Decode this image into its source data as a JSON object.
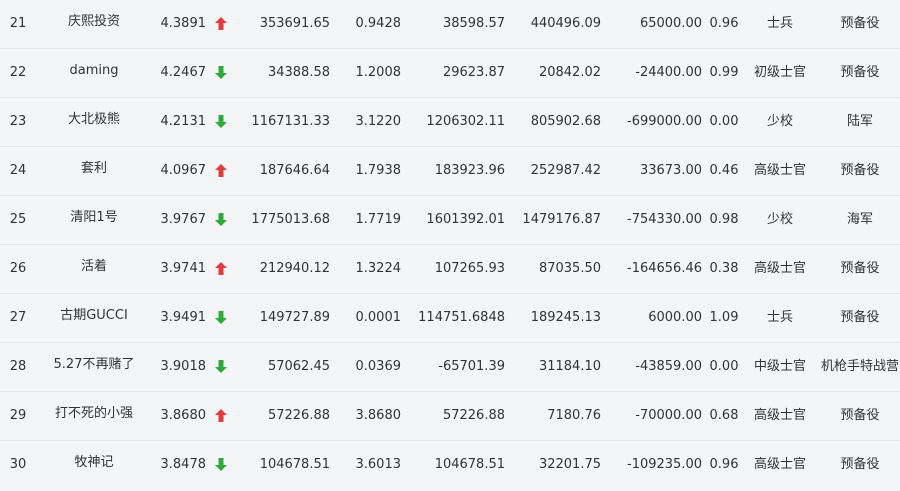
{
  "colors": {
    "up": "#e23b3b",
    "down": "#2faa3a"
  },
  "rows": [
    {
      "rank": "21",
      "name": "庆熙投资",
      "score": "4.3891",
      "trend": "up",
      "v1": "353691.65",
      "v2": "0.9428",
      "v3": "38598.57",
      "v4": "440496.09",
      "v5": "65000.00",
      "v6": "0.96",
      "military_rank": "士兵",
      "unit": "预备役"
    },
    {
      "rank": "22",
      "name": "daming",
      "score": "4.2467",
      "trend": "down",
      "v1": "34388.58",
      "v2": "1.2008",
      "v3": "29623.87",
      "v4": "20842.02",
      "v5": "-24400.00",
      "v6": "0.99",
      "military_rank": "初级士官",
      "unit": "预备役"
    },
    {
      "rank": "23",
      "name": "大北极熊",
      "score": "4.2131",
      "trend": "down",
      "v1": "1167131.33",
      "v2": "3.1220",
      "v3": "1206302.11",
      "v4": "805902.68",
      "v5": "-699000.00",
      "v6": "0.00",
      "military_rank": "少校",
      "unit": "陆军"
    },
    {
      "rank": "24",
      "name": "套利",
      "score": "4.0967",
      "trend": "up",
      "v1": "187646.64",
      "v2": "1.7938",
      "v3": "183923.96",
      "v4": "252987.42",
      "v5": "33673.00",
      "v6": "0.46",
      "military_rank": "高级士官",
      "unit": "预备役"
    },
    {
      "rank": "25",
      "name": "清阳1号",
      "score": "3.9767",
      "trend": "down",
      "v1": "1775013.68",
      "v2": "1.7719",
      "v3": "1601392.01",
      "v4": "1479176.87",
      "v5": "-754330.00",
      "v6": "0.98",
      "military_rank": "少校",
      "unit": "海军"
    },
    {
      "rank": "26",
      "name": "活着",
      "score": "3.9741",
      "trend": "up",
      "v1": "212940.12",
      "v2": "1.3224",
      "v3": "107265.93",
      "v4": "87035.50",
      "v5": "-164656.46",
      "v6": "0.38",
      "military_rank": "高级士官",
      "unit": "预备役"
    },
    {
      "rank": "27",
      "name": "古期GUCCI",
      "score": "3.9491",
      "trend": "down",
      "v1": "149727.89",
      "v2": "0.0001",
      "v3": "114751.6848",
      "v4": "189245.13",
      "v5": "6000.00",
      "v6": "1.09",
      "military_rank": "士兵",
      "unit": "预备役"
    },
    {
      "rank": "28",
      "name": "5.27不再赌了",
      "score": "3.9018",
      "trend": "down",
      "v1": "57062.45",
      "v2": "0.0369",
      "v3": "-65701.39",
      "v4": "31184.10",
      "v5": "-43859.00",
      "v6": "0.00",
      "military_rank": "中级士官",
      "unit": "机枪手特战营"
    },
    {
      "rank": "29",
      "name": "打不死的小强",
      "score": "3.8680",
      "trend": "up",
      "v1": "57226.88",
      "v2": "3.8680",
      "v3": "57226.88",
      "v4": "7180.76",
      "v5": "-70000.00",
      "v6": "0.68",
      "military_rank": "高级士官",
      "unit": "预备役"
    },
    {
      "rank": "30",
      "name": "牧神记",
      "score": "3.8478",
      "trend": "down",
      "v1": "104678.51",
      "v2": "3.6013",
      "v3": "104678.51",
      "v4": "32201.75",
      "v5": "-109235.00",
      "v6": "0.96",
      "military_rank": "高级士官",
      "unit": "预备役"
    }
  ]
}
